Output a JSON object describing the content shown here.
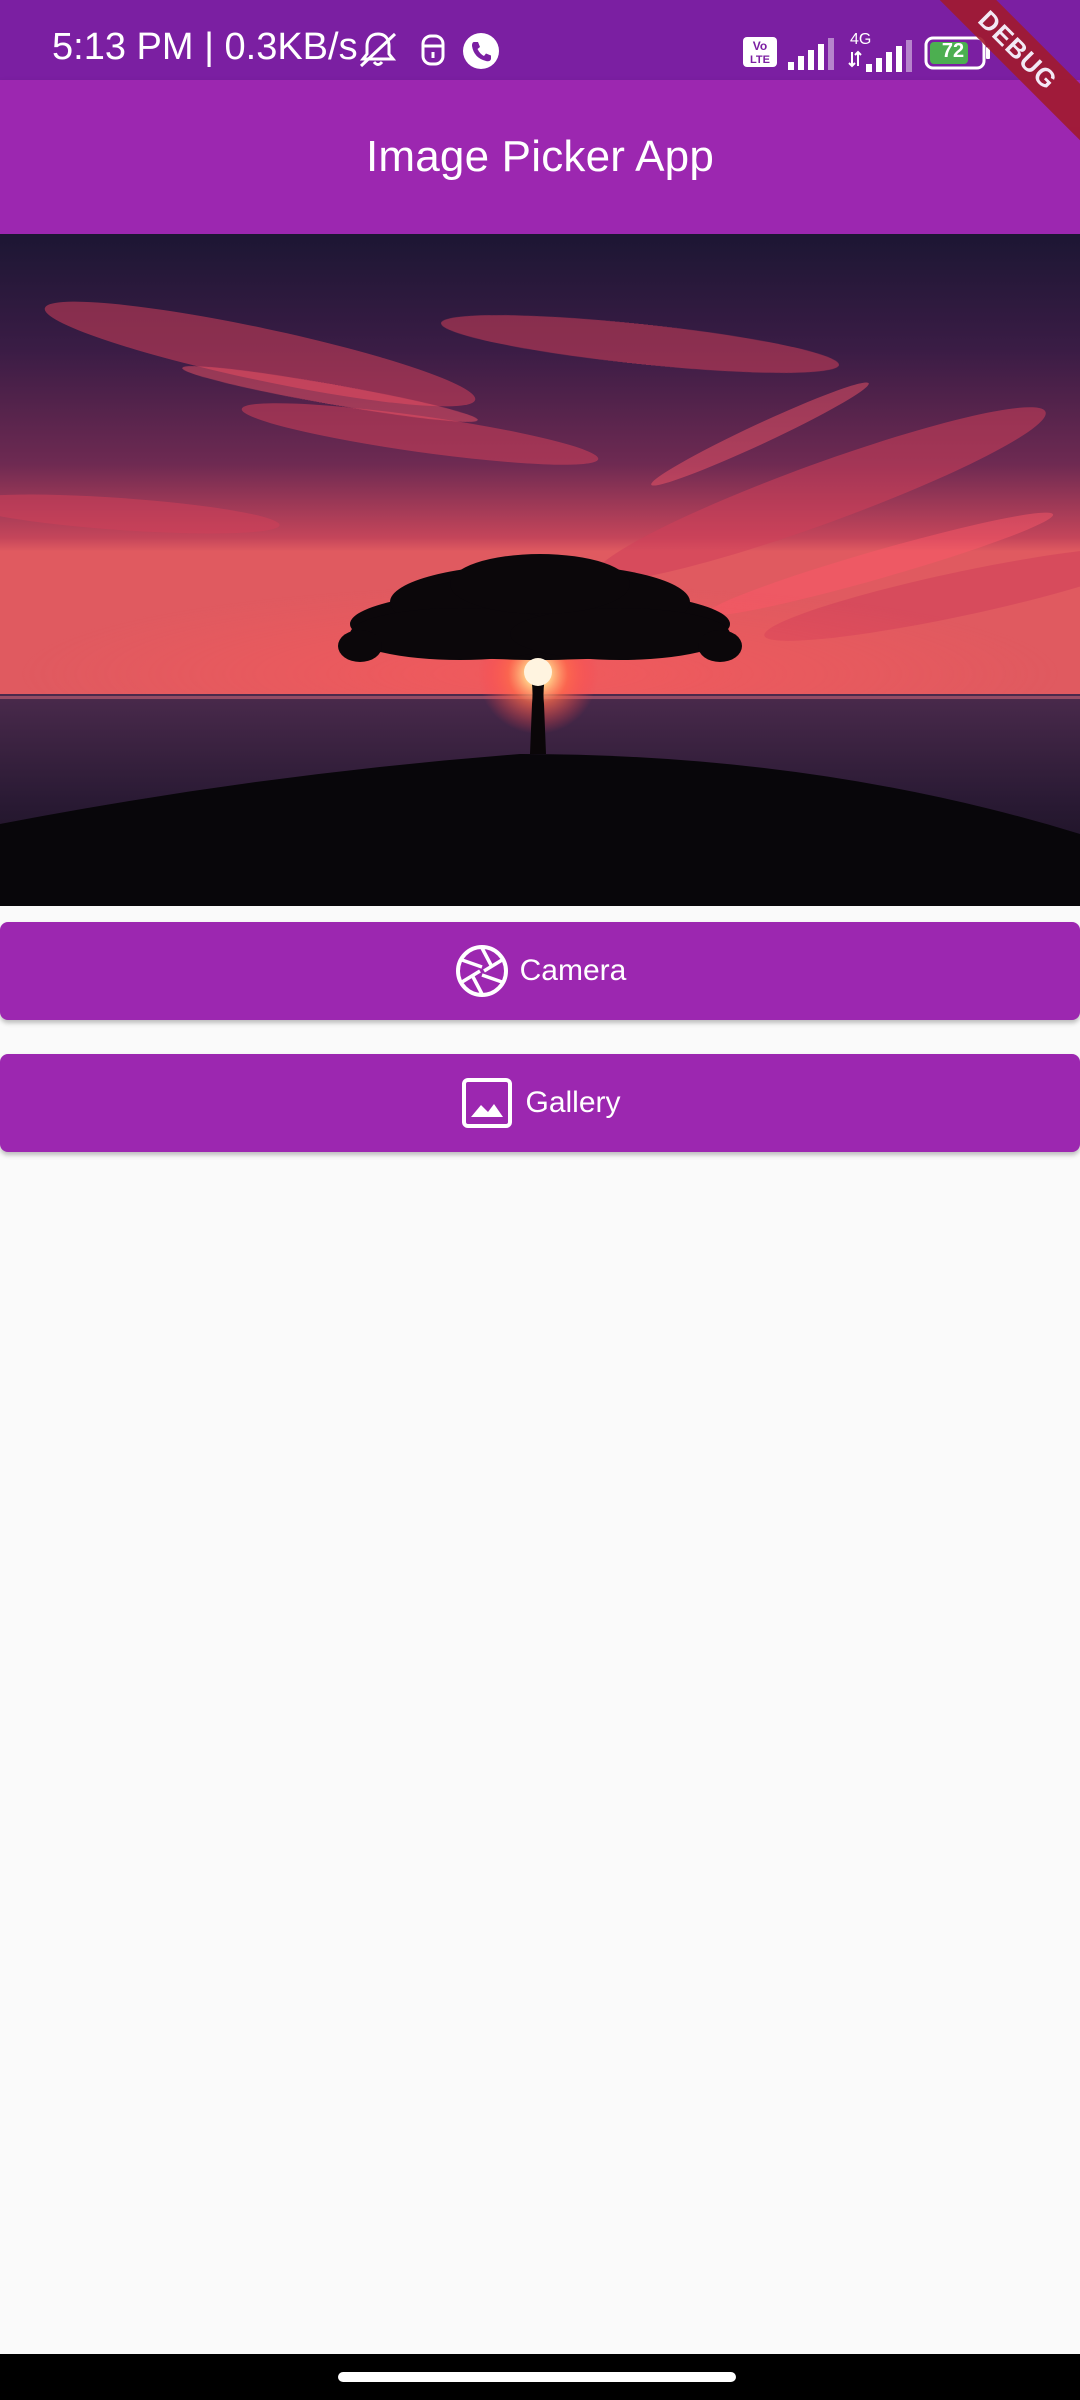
{
  "status_bar": {
    "time": "5:13 PM | 0.3KB/s",
    "volte": "Vo LTE",
    "network": "4G",
    "battery": "72"
  },
  "app_bar": {
    "title": "Image Picker App"
  },
  "image": {
    "description_icon": "sunset-tree-image"
  },
  "buttons": {
    "camera": {
      "label": "Camera",
      "icon": "camera-aperture-icon"
    },
    "gallery": {
      "label": "Gallery",
      "icon": "image-icon"
    }
  },
  "debug_banner": {
    "label": "DEBUG"
  },
  "colors": {
    "primary": "#9c27b0",
    "primary_dark": "#7b1fa2",
    "background": "#fafafa",
    "debug": "#a11a2e"
  }
}
